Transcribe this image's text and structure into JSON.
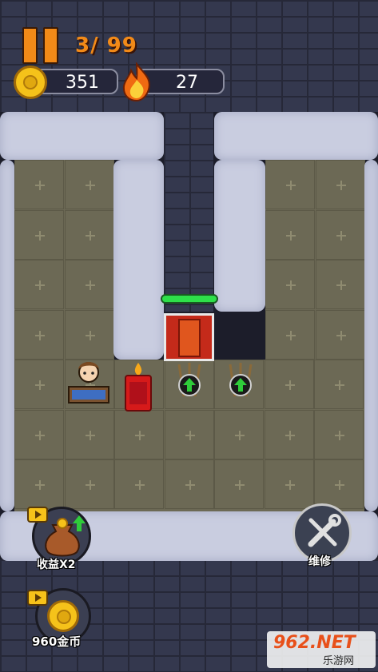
{
  "hud": {
    "level": "3/ 99",
    "coins": "351",
    "fire": "27"
  },
  "buttons": {
    "income_label": "收益X2",
    "repair_label": "维修",
    "coins_label": "960金币"
  },
  "watermark": {
    "text": "962.NET",
    "subtext": "乐游网"
  }
}
